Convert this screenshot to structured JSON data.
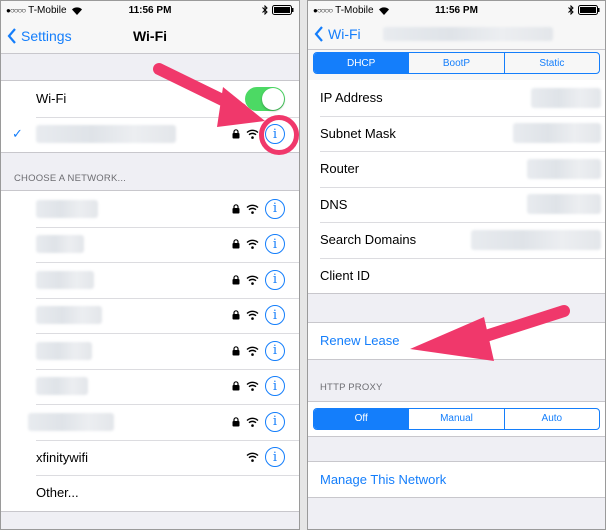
{
  "status_bar": {
    "signal_dots": "●○○○○",
    "carrier": "T-Mobile",
    "time": "11:56 PM"
  },
  "left_screen": {
    "back_label": "Settings",
    "title": "Wi-Fi",
    "wifi_toggle": {
      "label": "Wi-Fi",
      "on": true
    },
    "section_header": "CHOOSE A NETWORK...",
    "networks": [
      {
        "name": "",
        "locked": true
      },
      {
        "name": "",
        "locked": true
      },
      {
        "name": "",
        "locked": true
      },
      {
        "name": "",
        "locked": true
      },
      {
        "name": "",
        "locked": true
      },
      {
        "name": "",
        "locked": true
      },
      {
        "name": "",
        "locked": true
      },
      {
        "name": "xfinitywifi",
        "locked": false
      }
    ],
    "other_label": "Other..."
  },
  "right_screen": {
    "back_label": "Wi-Fi",
    "ip_modes": [
      "DHCP",
      "BootP",
      "Static"
    ],
    "ip_mode_selected": "DHCP",
    "fields": [
      "IP Address",
      "Subnet Mask",
      "Router",
      "DNS",
      "Search Domains",
      "Client ID"
    ],
    "renew_lease": "Renew Lease",
    "http_proxy_header": "HTTP PROXY",
    "proxy_modes": [
      "Off",
      "Manual",
      "Auto"
    ],
    "proxy_selected": "Off",
    "manage_network": "Manage This Network"
  },
  "colors": {
    "accent": "#147efb",
    "toggle_on": "#4cd964",
    "highlight_arrow": "#f0386b"
  },
  "icons": [
    "wifi-icon",
    "lock-icon",
    "info-icon",
    "checkmark-icon",
    "chevron-left-icon",
    "bluetooth-icon",
    "battery-icon"
  ]
}
